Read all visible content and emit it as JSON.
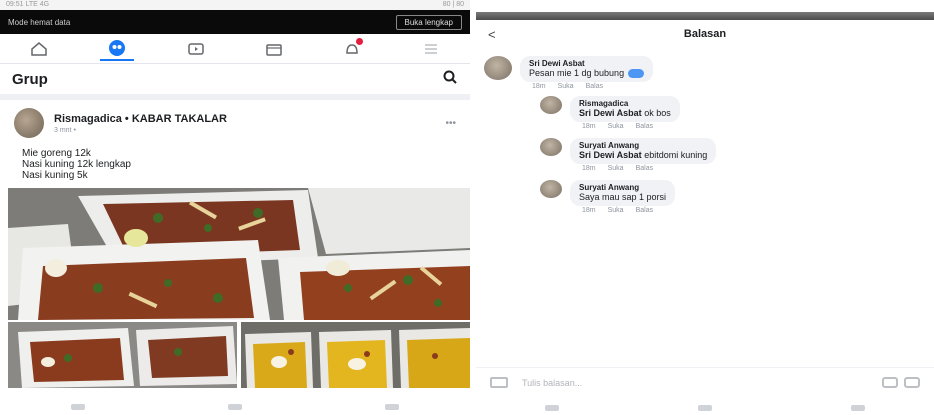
{
  "left": {
    "status_bar": "09:51 LTE 4G",
    "status_right": "80 | 80",
    "mode_text": "Mode hemat data",
    "mode_button": "Buka lengkap",
    "nav_icons": [
      "home-icon",
      "groups-icon",
      "watch-icon",
      "marketplace-icon",
      "notifications-icon",
      "menu-icon"
    ],
    "header_title": "Grup",
    "post": {
      "author": "Rismagadica • KABAR TAKALAR",
      "subtitle": "3 mnt • ",
      "text_lines": [
        "Mie goreng 12k",
        "Nasi kuning 12k lengkap",
        "Nasi kuning 5k"
      ]
    },
    "photos": {
      "main": "food-photo-main",
      "thumbs": [
        "food-photo-thumb-1",
        "food-photo-thumb-2"
      ]
    }
  },
  "right": {
    "title": "Balasan",
    "back": "<",
    "comments": [
      {
        "name": "Sri Dewi Asbat",
        "text": "Pesan mie 1 dg bubung",
        "mention": "",
        "actions": [
          "18m",
          "Suka",
          "Balas"
        ]
      },
      {
        "name": "Rismagadica",
        "mention": "Sri Dewi Asbat",
        "text": " ok bos",
        "actions": [
          "18m",
          "Suka",
          "Balas"
        ]
      },
      {
        "name": "Suryati Anwang",
        "mention": "Sri Dewi Asbat",
        "text": " ebitdomi kuning",
        "actions": [
          "18m",
          "Suka",
          "Balas"
        ]
      },
      {
        "name": "Suryati Anwang",
        "mention": "",
        "text": "Saya mau sap 1 porsi",
        "actions": [
          "18m",
          "Suka",
          "Balas"
        ]
      }
    ],
    "reply_placeholder": "Tulis balasan..."
  },
  "colors": {
    "accent": "#1877f2",
    "notification": "#e41e3f",
    "bubble": "#f0f2f5"
  }
}
